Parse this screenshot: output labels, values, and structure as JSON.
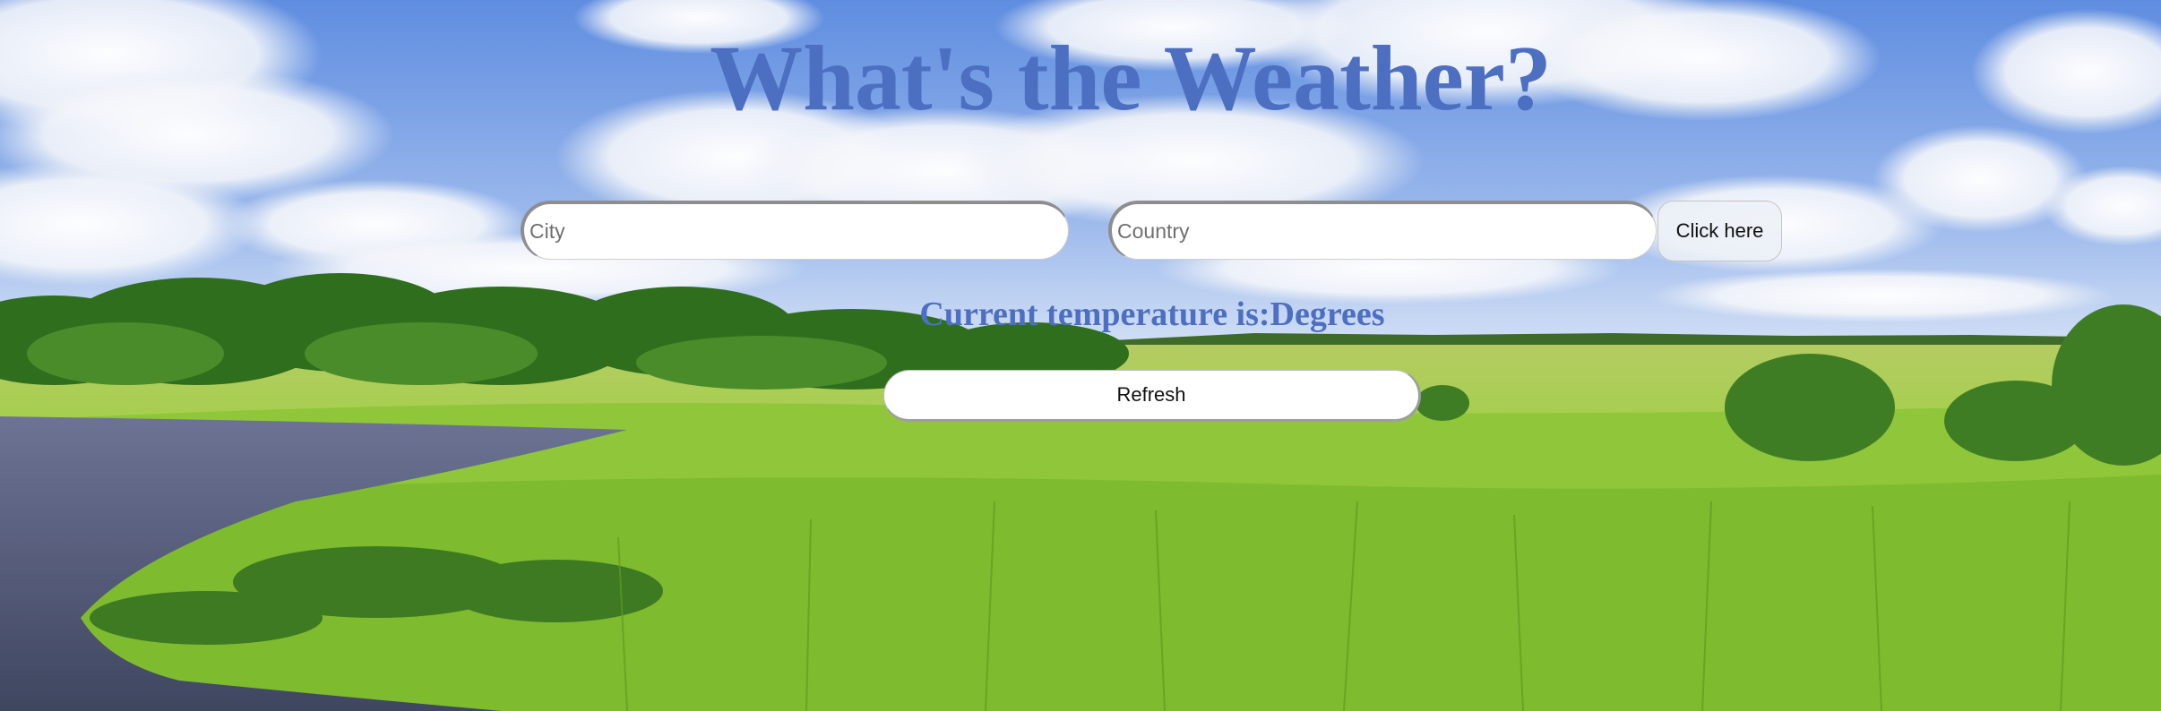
{
  "page": {
    "title": "What's the Weather?"
  },
  "form": {
    "city_placeholder": "City",
    "city_value": "",
    "country_placeholder": "Country",
    "country_value": "",
    "submit_label": "Click here"
  },
  "result": {
    "temperature_text": "Current temperature is:Degrees"
  },
  "actions": {
    "refresh_label": "Refresh"
  },
  "colors": {
    "heading": "#4d6fc2",
    "sky": "#6a93e0",
    "grass": "#8fc63a",
    "water": "#5a6a8c"
  }
}
